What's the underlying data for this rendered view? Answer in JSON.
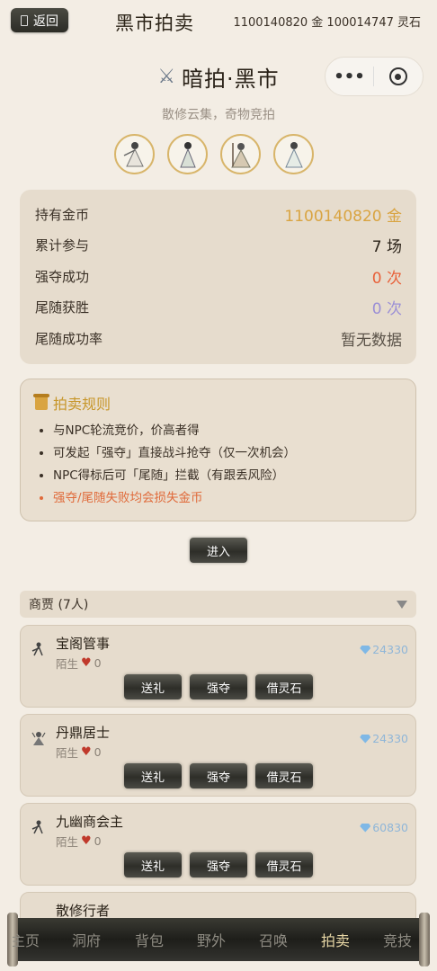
{
  "header": {
    "back_label": "返回",
    "title": "黑市拍卖",
    "currency_text": "1100140820 金  100014747 灵石"
  },
  "capsule": {
    "more": "•••"
  },
  "hero": {
    "title": "暗拍·黑市",
    "subtitle": "散修云集，奇物竞拍"
  },
  "stats": [
    {
      "label": "持有金币",
      "value": "1100140820 金",
      "color": "#d9a441"
    },
    {
      "label": "累计参与",
      "value": "7 场",
      "color": "#2a2218"
    },
    {
      "label": "强夺成功",
      "value": "0 次",
      "color": "#e8613a"
    },
    {
      "label": "尾随获胜",
      "value": "0 次",
      "color": "#9b8fd6"
    },
    {
      "label": "尾随成功率",
      "value": "暂无数据",
      "color": "#5a5248"
    }
  ],
  "rules": {
    "title": "拍卖规则",
    "items": [
      "与NPC轮流竞价，价高者得",
      "可发起「强夺」直接战斗抢夺（仅一次机会）",
      "NPC得标后可「尾随」拦截（有跟丢风险）",
      "强夺/尾随失败均会损失金币"
    ]
  },
  "enter_label": "进入",
  "merchants_section": {
    "title": "商贾 (7人)"
  },
  "merchants": [
    {
      "name": "宝阁管事",
      "relation": "陌生",
      "affection": "0",
      "value": "24330"
    },
    {
      "name": "丹鼎居士",
      "relation": "陌生",
      "affection": "0",
      "value": "24330"
    },
    {
      "name": "九幽商会主",
      "relation": "陌生",
      "affection": "0",
      "value": "60830"
    },
    {
      "name": "散修行者"
    }
  ],
  "merchant_actions": {
    "gift": "送礼",
    "rob": "强夺",
    "borrow": "借灵石"
  },
  "nav": {
    "items": [
      "主页",
      "洞府",
      "背包",
      "野外",
      "召唤",
      "拍卖",
      "竞技"
    ],
    "active": "拍卖"
  }
}
